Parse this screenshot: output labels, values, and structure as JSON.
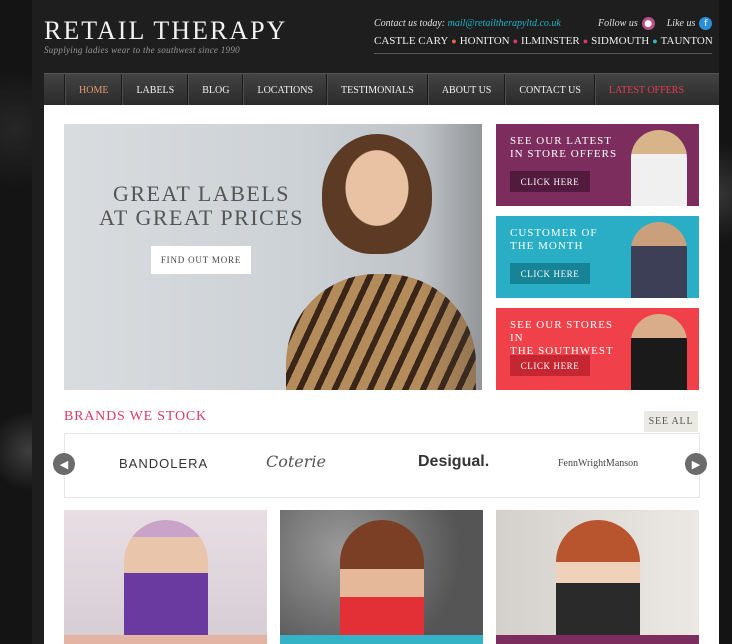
{
  "header": {
    "logo": "RETAIL THERAPY",
    "tagline": "Supplying ladies wear to the southwest since 1990",
    "contact_label": "Contact us today:",
    "contact_email": "mail@retailtherapyltd.co.uk",
    "follow_label": "Follow us",
    "like_label": "Like us",
    "locations": [
      "CASTLE CARY",
      "HONITON",
      "ILMINSTER",
      "SIDMOUTH",
      "TAUNTON"
    ]
  },
  "nav": {
    "items": [
      "HOME",
      "LABELS",
      "BLOG",
      "LOCATIONS",
      "TESTIMONIALS",
      "ABOUT US",
      "CONTACT US",
      "LATEST OFFERS"
    ]
  },
  "hero": {
    "title_line1": "GREAT LABELS",
    "title_line2": "AT GREAT PRICES",
    "button": "FIND OUT MORE"
  },
  "promos": [
    {
      "line1": "SEE OUR LATEST",
      "line2": "IN STORE OFFERS",
      "button": "CLICK HERE"
    },
    {
      "line1": "CUSTOMER OF",
      "line2": "THE MONTH",
      "button": "CLICK HERE"
    },
    {
      "line1": "SEE OUR STORES IN",
      "line2": "THE SOUTHWEST",
      "button": "CLICK HERE"
    }
  ],
  "brands": {
    "title": "BRANDS WE STOCK",
    "see_all": "SEE ALL",
    "logos": [
      "BANDOLERA",
      "Coterie",
      "Desigual.",
      "FennWrightManson"
    ]
  },
  "colors": {
    "plum": "#7c2d5e",
    "teal": "#29aec5",
    "coral": "#f0414a",
    "brand_pink": "#e23a62"
  }
}
